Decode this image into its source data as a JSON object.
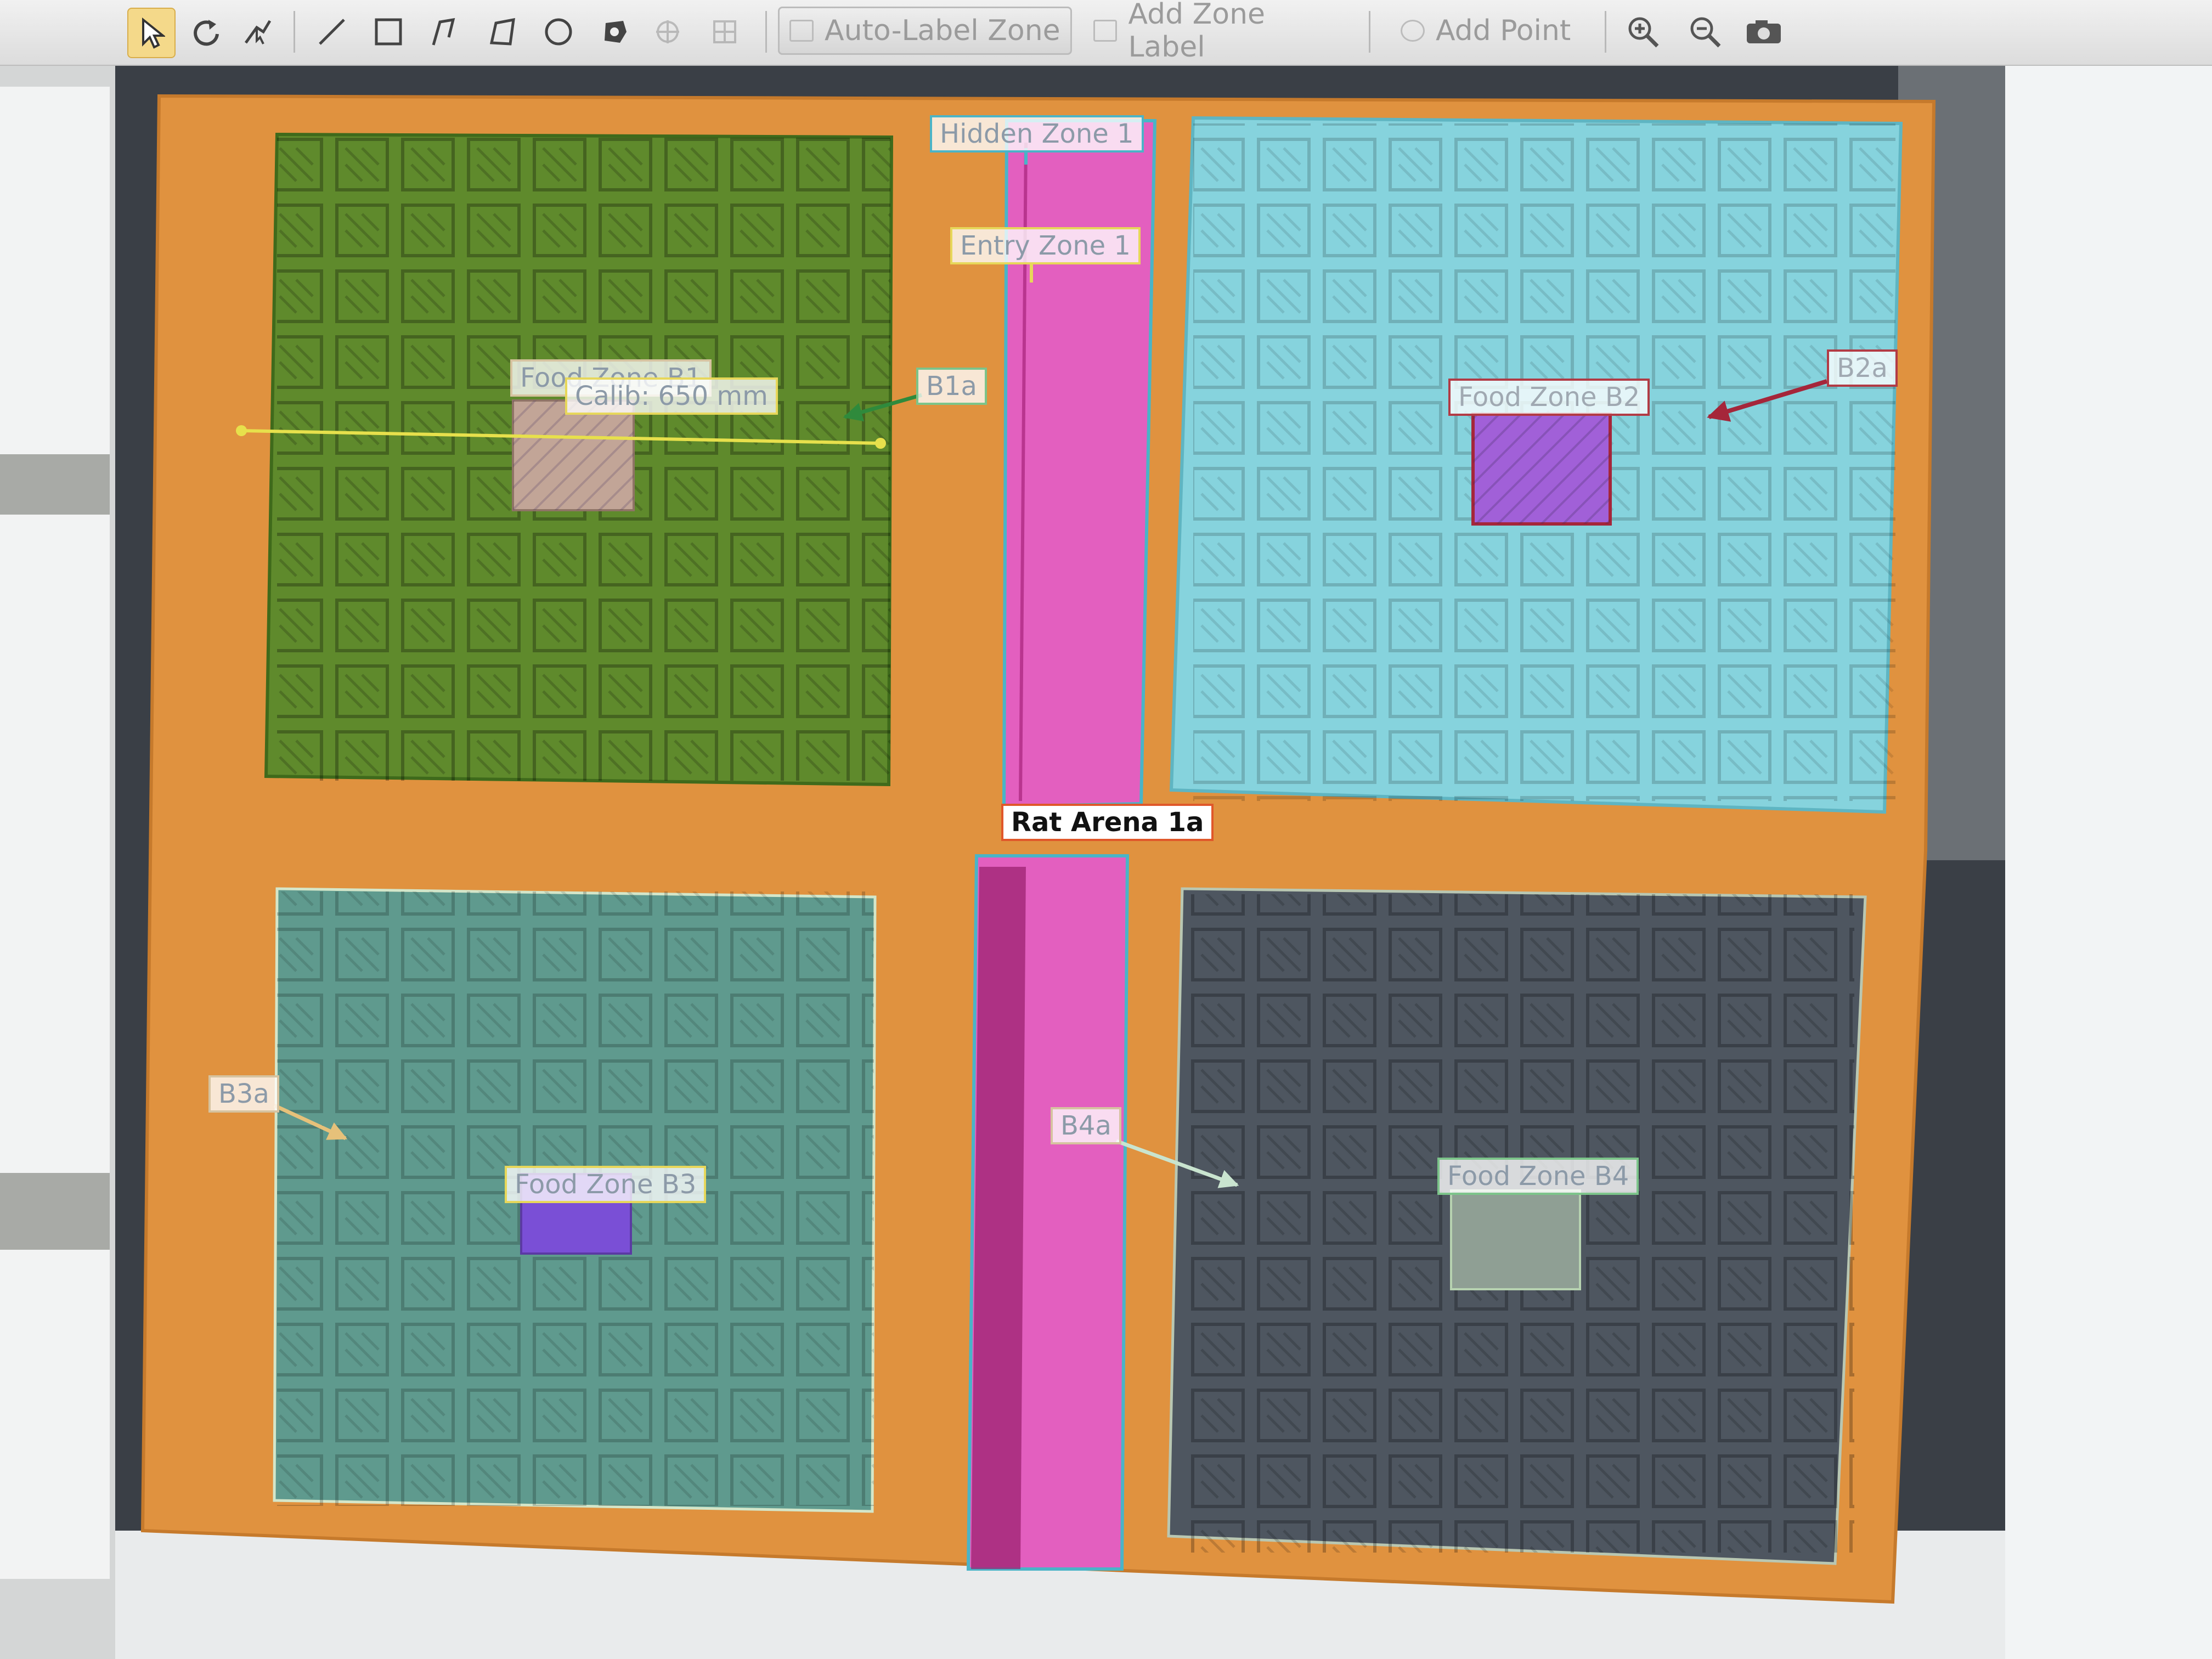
{
  "toolbar": {
    "tools": [
      {
        "id": "select",
        "icon": "pointer-arrow-icon"
      },
      {
        "id": "rotate",
        "icon": "rotate-icon"
      },
      {
        "id": "point-select",
        "icon": "point-select-icon"
      },
      {
        "id": "line",
        "icon": "line-icon"
      },
      {
        "id": "rectangle",
        "icon": "rectangle-icon"
      },
      {
        "id": "polyline",
        "icon": "polyline-icon"
      },
      {
        "id": "polygon",
        "icon": "polygon-icon"
      },
      {
        "id": "ellipse",
        "icon": "ellipse-icon"
      },
      {
        "id": "freeform",
        "icon": "blob-icon"
      }
    ],
    "auto_label_zone": "Auto-Label Zone",
    "add_zone_label": "Add Zone Label",
    "add_point": "Add Point",
    "zoom_in_icon": "zoom-in-icon",
    "zoom_out_icon": "zoom-out-icon",
    "snapshot_icon": "camera-icon"
  },
  "zones": {
    "hidden_zone": "Hidden Zone 1",
    "entry_zone": "Entry Zone 1",
    "arena": "Rat Arena 1a",
    "b1a": "B1a",
    "b2a": "B2a",
    "b3a": "B3a",
    "b4a": "B4a",
    "food_b1": "Food Zone B1",
    "food_b2": "Food Zone B2",
    "food_b3": "Food Zone B3",
    "food_b4": "Food Zone B4",
    "calibration": "Calib: 650 mm"
  },
  "colors": {
    "arena": "#e0923f",
    "hidden_zone": "#e35fbf",
    "b1": "#5f8a2c",
    "b2": "#86d3dd",
    "b3": "#5f9a8e",
    "b4": "#4e5660",
    "food_b2": "#a160d8",
    "food_b3": "#7a4fd6",
    "calibration_line": "#e7e04c"
  }
}
